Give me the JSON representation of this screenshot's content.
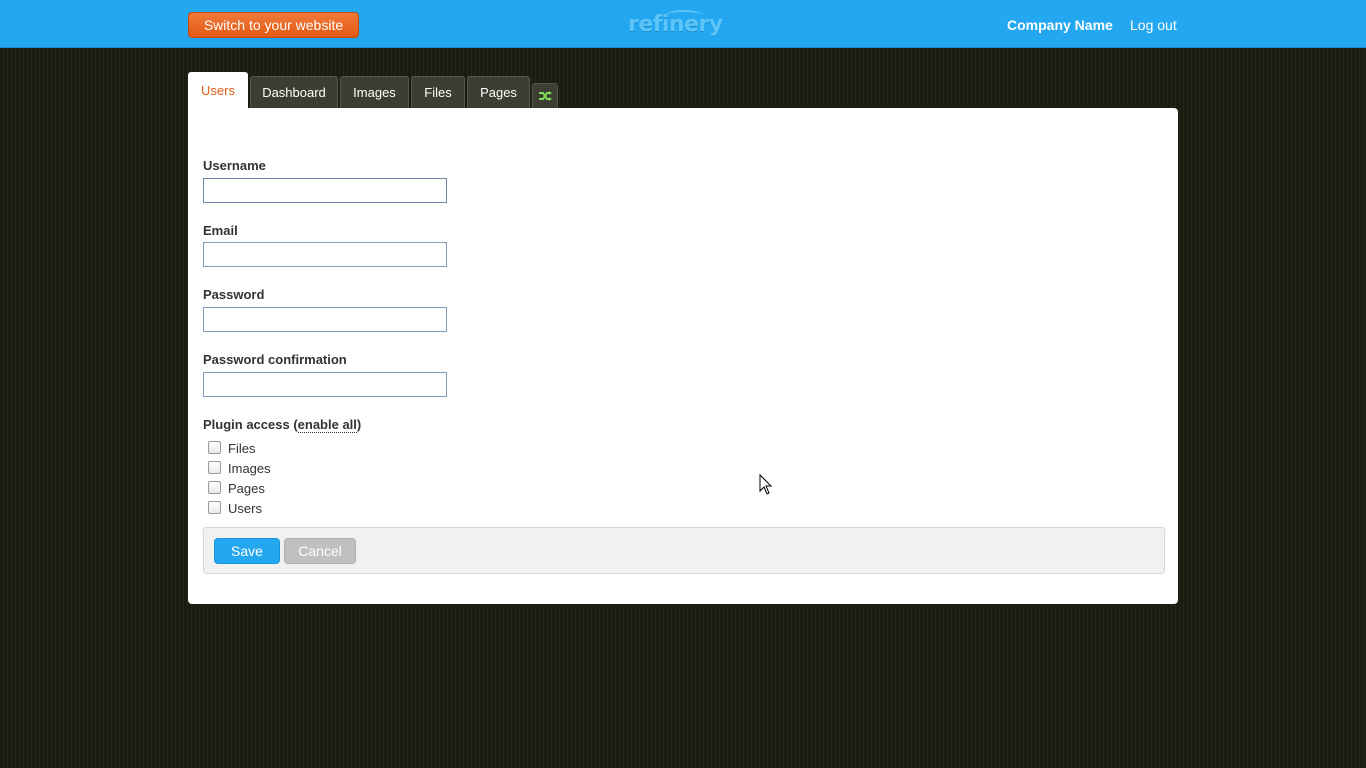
{
  "header": {
    "switch_label": "Switch to your website",
    "logo_text": "refinery",
    "company_name": "Company Name",
    "logout_label": "Log out",
    "bar_color": "#22a7f0",
    "switch_color": "#e35a14"
  },
  "tabs": [
    {
      "label": "Users",
      "active": true
    },
    {
      "label": "Dashboard",
      "active": false
    },
    {
      "label": "Images",
      "active": false
    },
    {
      "label": "Files",
      "active": false
    },
    {
      "label": "Pages",
      "active": false
    }
  ],
  "tab_extra": {
    "icon": "reorder-icon"
  },
  "form": {
    "username_label": "Username",
    "username_value": "",
    "email_label": "Email",
    "email_value": "",
    "password_label": "Password",
    "password_value": "",
    "password_confirmation_label": "Password confirmation",
    "password_confirmation_value": "",
    "plugin_access_label": "Plugin access (",
    "enable_all_label": "enable all",
    "plugin_access_close": ")",
    "plugins": [
      {
        "label": "Files",
        "checked": false
      },
      {
        "label": "Images",
        "checked": false
      },
      {
        "label": "Pages",
        "checked": false
      },
      {
        "label": "Users",
        "checked": false
      }
    ]
  },
  "actions": {
    "save_label": "Save",
    "cancel_label": "Cancel"
  }
}
